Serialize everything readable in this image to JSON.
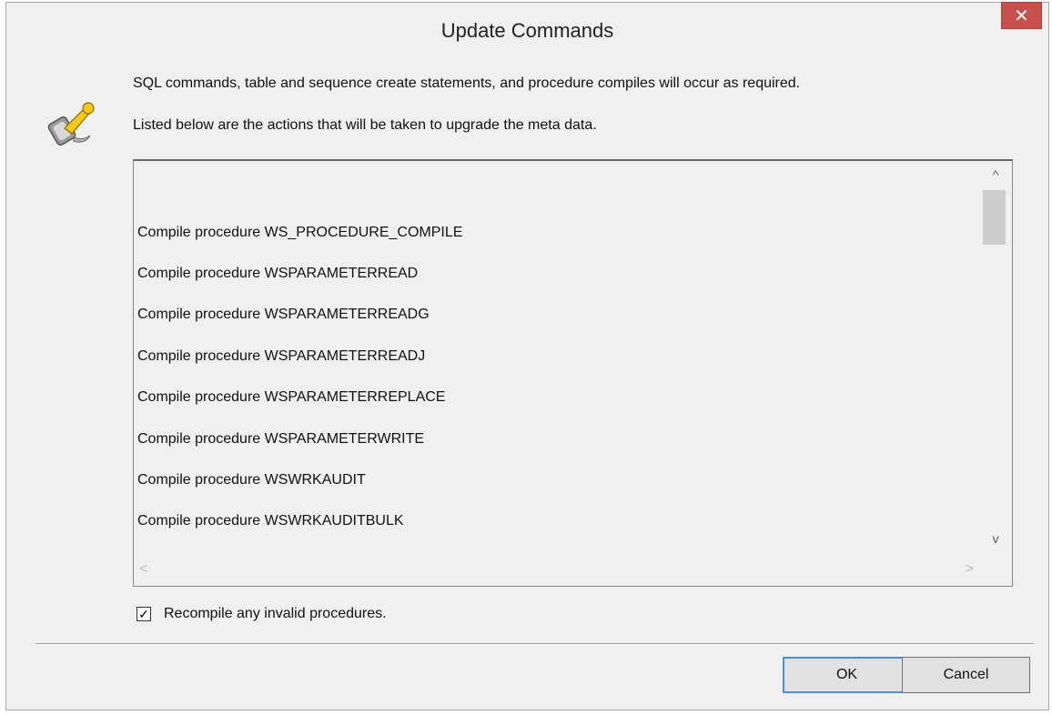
{
  "window": {
    "title": "Update Commands",
    "close_glyph": "✕"
  },
  "icon": {
    "name": "wrench-tools-icon"
  },
  "description": {
    "line1": "SQL commands, table and sequence create statements, and procedure compiles will occur as required.",
    "line2": "Listed below are the actions that will be taken to upgrade the meta data."
  },
  "list": {
    "items": [
      "Compile procedure WS_PROCEDURE_COMPILE",
      "Compile procedure WSPARAMETERREAD",
      "Compile procedure WSPARAMETERREADG",
      "Compile procedure WSPARAMETERREADJ",
      "Compile procedure WSPARAMETERREPLACE",
      "Compile procedure WSPARAMETERWRITE",
      "Compile procedure WSWRKAUDIT",
      "Compile procedure WSWRKAUDITBULK"
    ],
    "scroll_up_glyph": "^",
    "scroll_down_glyph": "v",
    "scroll_left_glyph": "<",
    "scroll_right_glyph": ">"
  },
  "recompile": {
    "label": "Recompile any invalid procedures.",
    "checked": true,
    "check_glyph": "✓"
  },
  "buttons": {
    "ok": "OK",
    "cancel": "Cancel"
  }
}
